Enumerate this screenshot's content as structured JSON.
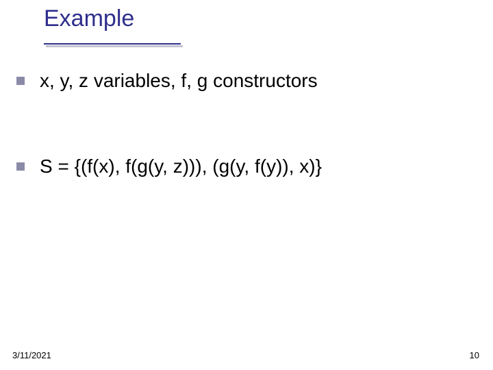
{
  "slide": {
    "title": "Example",
    "bullets": [
      "x, y, z variables, f, g constructors",
      "S = {(f(x), f(g(y, z))), (g(y, f(y)), x)}"
    ],
    "footer": {
      "date": "3/11/2021",
      "page": "10"
    }
  }
}
